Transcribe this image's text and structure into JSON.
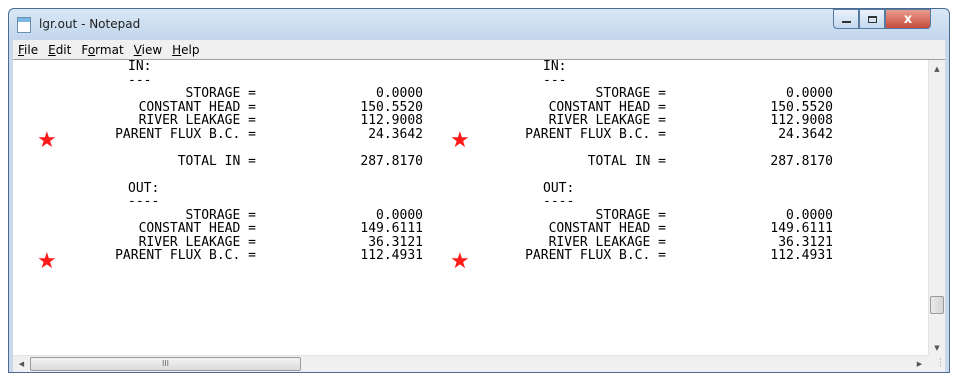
{
  "window": {
    "title": "lgr.out - Notepad",
    "close_glyph": "x"
  },
  "menu": [
    {
      "pre": "",
      "key": "F",
      "post": "ile"
    },
    {
      "pre": "",
      "key": "E",
      "post": "dit"
    },
    {
      "pre": "F",
      "key": "o",
      "post": "rmat"
    },
    {
      "pre": "",
      "key": "V",
      "post": "iew"
    },
    {
      "pre": "",
      "key": "H",
      "post": "elp"
    }
  ],
  "content": {
    "left": {
      "in_header": "IN:",
      "in_dash": "---",
      "in_storage_label": "STORAGE =",
      "in_storage_value": "0.0000",
      "in_constant_label": "CONSTANT HEAD =",
      "in_constant_value": "150.5520",
      "in_river_label": "RIVER LEAKAGE =",
      "in_river_value": "112.9008",
      "in_parent_label": "PARENT FLUX B.C. =",
      "in_parent_value": "24.3642",
      "total_in_label": "TOTAL IN =",
      "total_in_value": "287.8170",
      "out_header": "OUT:",
      "out_dash": "----",
      "out_storage_label": "STORAGE =",
      "out_storage_value": "0.0000",
      "out_constant_label": "CONSTANT HEAD =",
      "out_constant_value": "149.6111",
      "out_river_label": "RIVER LEAKAGE =",
      "out_river_value": "36.3121",
      "out_parent_label": "PARENT FLUX B.C. =",
      "out_parent_value": "112.4931"
    },
    "right": {
      "in_header": "IN:",
      "in_dash": "---",
      "in_storage_label": "STORAGE =",
      "in_storage_value": "0.0000",
      "in_constant_label": "CONSTANT HEAD =",
      "in_constant_value": "150.5520",
      "in_river_label": "RIVER LEAKAGE =",
      "in_river_value": "112.9008",
      "in_parent_label": "PARENT FLUX B.C. =",
      "in_parent_value": "24.3642",
      "total_in_label": "TOTAL IN =",
      "total_in_value": "287.8170",
      "out_header": "OUT:",
      "out_dash": "----",
      "out_storage_label": "STORAGE =",
      "out_storage_value": "0.0000",
      "out_constant_label": "CONSTANT HEAD =",
      "out_constant_value": "149.6111",
      "out_river_label": "RIVER LEAKAGE =",
      "out_river_value": "36.3121",
      "out_parent_label": "PARENT FLUX B.C. =",
      "out_parent_value": "112.4931"
    }
  },
  "annotation": {
    "star_color": "#ff1a1a"
  },
  "scroll": {
    "h_thumb_grip": "III"
  }
}
